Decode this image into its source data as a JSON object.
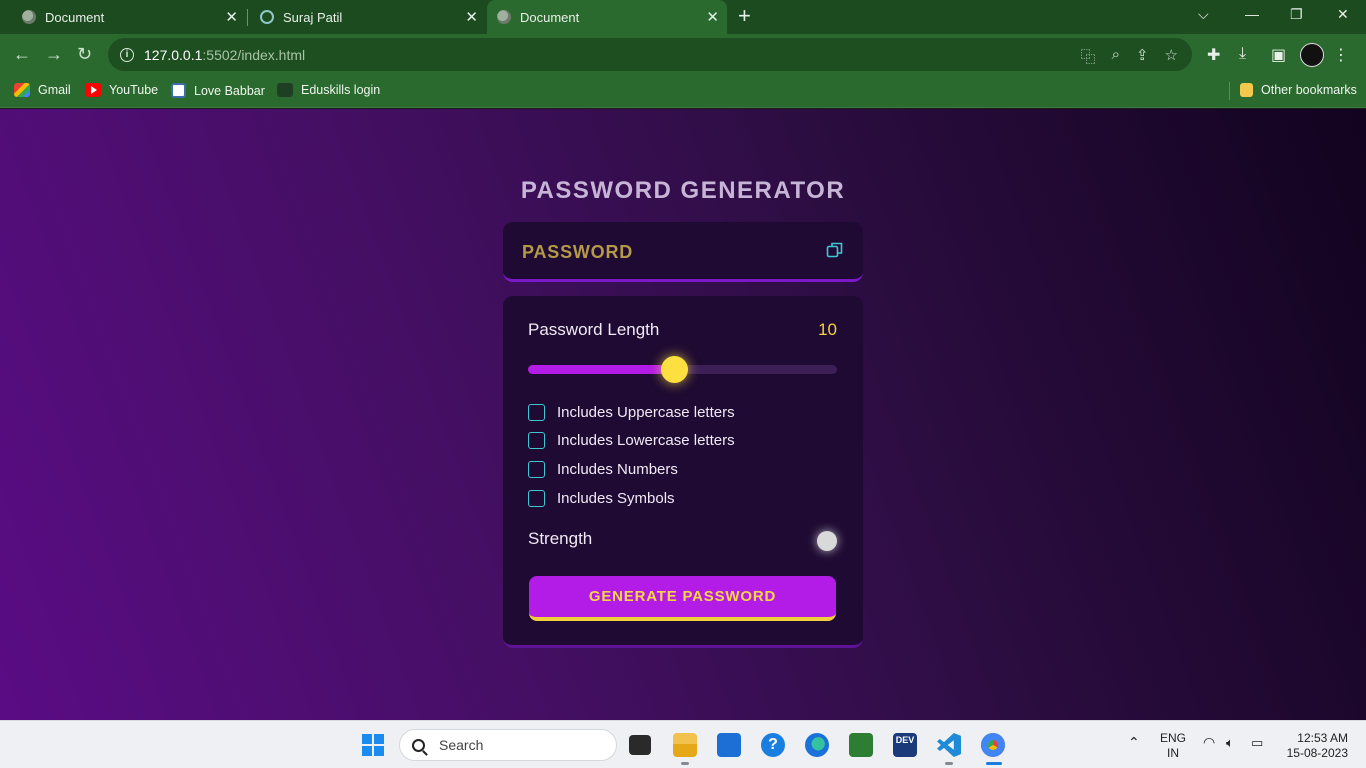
{
  "browser": {
    "tabs": [
      {
        "title": "Document",
        "icon": "globe-icon"
      },
      {
        "title": "Suraj Patil",
        "icon": "ring-icon"
      },
      {
        "title": "Document",
        "icon": "globe-icon",
        "active": true
      }
    ],
    "url_host": "127.0.0.1",
    "url_rest": ":5502/index.html",
    "bookmarks": [
      {
        "label": "Gmail",
        "icon": "gmail-icon"
      },
      {
        "label": "YouTube",
        "icon": "youtube-icon"
      },
      {
        "label": "Love Babbar",
        "icon": "love-babbar-icon"
      },
      {
        "label": "Eduskills login",
        "icon": "eduskills-icon"
      }
    ],
    "other_bookmarks": "Other bookmarks",
    "colors": {
      "frame": "#1c4b1f",
      "toolbar": "#2a6a2e"
    }
  },
  "app": {
    "title": "PASSWORD GENERATOR",
    "password_placeholder": "PASSWORD",
    "length_label": "Password Length",
    "length_value": "10",
    "slider_fraction": 0.475,
    "options": [
      {
        "label": "Includes Uppercase letters",
        "checked": false
      },
      {
        "label": "Includes Lowercase letters",
        "checked": false
      },
      {
        "label": "Includes Numbers",
        "checked": false
      },
      {
        "label": "Includes Symbols",
        "checked": false
      }
    ],
    "strength_label": "Strength",
    "generate_label": "GENERATE PASSWORD",
    "colors": {
      "accent": "#b31be6",
      "yellow": "#f4d33c",
      "checkbox": "#3fc8d4",
      "panel": "#1e0a32"
    }
  },
  "taskbar": {
    "search_placeholder": "Search",
    "lang_top": "ENG",
    "lang_bottom": "IN",
    "time": "12:53 AM",
    "date": "15-08-2023"
  }
}
